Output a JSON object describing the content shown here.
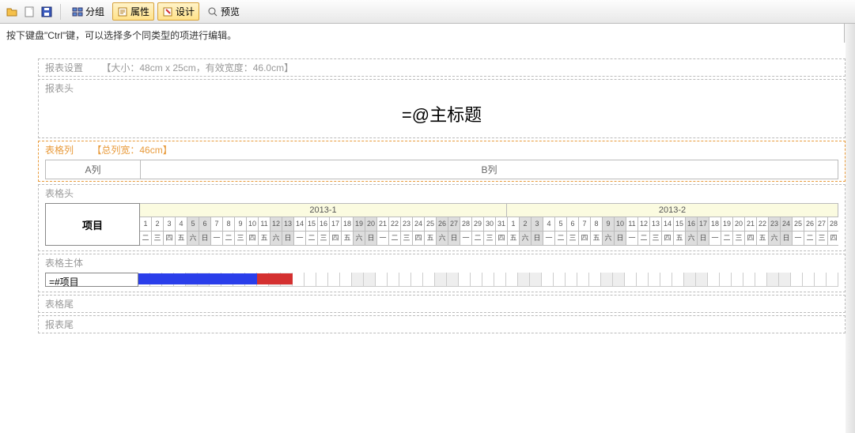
{
  "toolbar": {
    "group": "分组",
    "attrs": "属性",
    "design": "设计",
    "preview": "预览"
  },
  "hint": "按下键盘\"Ctrl\"键，可以选择多个同类型的项进行编辑。",
  "sections": {
    "settings_label": "报表设置",
    "settings_extra": "【大小：48cm x 25cm，有效宽度：46.0cm】",
    "header_label": "报表头",
    "title_text": "=@主标题",
    "cols_label": "表格列",
    "cols_extra": "【总列宽：46cm】",
    "colA": "A列",
    "colB": "B列",
    "thead_label": "表格头",
    "project_header": "项目",
    "month1": "2013-1",
    "month2": "2013-2",
    "body_label": "表格主体",
    "project_field": "=#项目",
    "tfoot_label": "表格尾",
    "rfoot_label": "报表尾"
  },
  "chart_data": {
    "type": "gantt-header",
    "months": [
      {
        "label": "2013-1",
        "days": 31
      },
      {
        "label": "2013-2",
        "days": 28
      }
    ],
    "day_numbers_m1": [
      1,
      2,
      3,
      4,
      5,
      6,
      7,
      8,
      9,
      10,
      11,
      12,
      13,
      14,
      15,
      16,
      17,
      18,
      19,
      20,
      21,
      22,
      23,
      24,
      25,
      26,
      27,
      28,
      29,
      30,
      31
    ],
    "day_numbers_m2": [
      1,
      2,
      3,
      4,
      5,
      6,
      7,
      8,
      9,
      10,
      11,
      12,
      13,
      14,
      15,
      16,
      17,
      18,
      19,
      20,
      21,
      22,
      23,
      24,
      25,
      26,
      27,
      28
    ],
    "weekday_cycle": [
      "一",
      "二",
      "三",
      "四",
      "五",
      "六",
      "日"
    ],
    "weekday_start_index_m1": 1,
    "weekday_start_index_m2": 4,
    "gantt_bar": {
      "start_day": 1,
      "blue_len": 10,
      "red_len": 3
    }
  }
}
